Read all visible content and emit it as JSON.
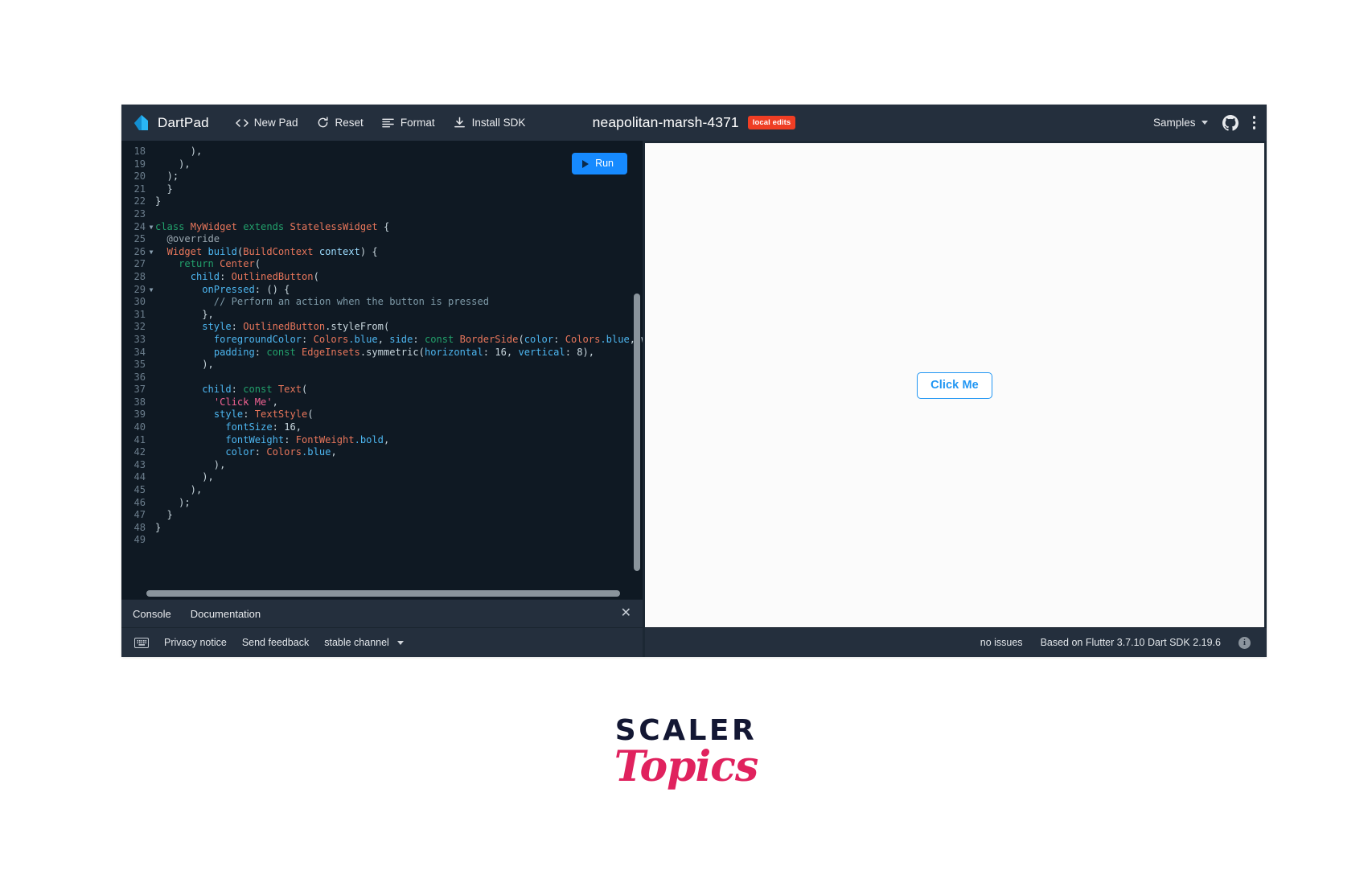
{
  "app": {
    "brand": "DartPad",
    "brand_logo_icon": "dart-bird-logo",
    "doc_title": "neapolitan-marsh-4371",
    "local_edits_badge": "local edits"
  },
  "toolbar": {
    "items": [
      {
        "label": "New Pad",
        "icon": "code-brackets-icon"
      },
      {
        "label": "Reset",
        "icon": "refresh-icon"
      },
      {
        "label": "Format",
        "icon": "format-lines-icon"
      },
      {
        "label": "Install SDK",
        "icon": "download-icon"
      }
    ]
  },
  "header_right": {
    "samples_label": "Samples",
    "samples_chevron_icon": "chevron-down-icon",
    "github_icon": "github-icon",
    "more_icon": "more-vertical-icon"
  },
  "editor": {
    "run_button_label": "Run",
    "run_button_icon": "play-icon",
    "first_line": 18,
    "lines": [
      {
        "n": 18,
        "fold": false,
        "tokens": [
          {
            "t": "      ",
            "c": "pn"
          },
          {
            "t": "),",
            "c": "pn"
          }
        ]
      },
      {
        "n": 19,
        "fold": false,
        "tokens": [
          {
            "t": "    ",
            "c": "pn"
          },
          {
            "t": "),",
            "c": "pn"
          }
        ]
      },
      {
        "n": 20,
        "fold": false,
        "tokens": [
          {
            "t": "  ",
            "c": "pn"
          },
          {
            "t": ");",
            "c": "pn"
          }
        ]
      },
      {
        "n": 21,
        "fold": false,
        "tokens": [
          {
            "t": "  }",
            "c": "pn"
          }
        ]
      },
      {
        "n": 22,
        "fold": false,
        "tokens": [
          {
            "t": "}",
            "c": "pn"
          }
        ]
      },
      {
        "n": 23,
        "fold": false,
        "tokens": []
      },
      {
        "n": 24,
        "fold": true,
        "tokens": [
          {
            "t": "class ",
            "c": "k"
          },
          {
            "t": "MyWidget ",
            "c": "ty"
          },
          {
            "t": "extends ",
            "c": "k"
          },
          {
            "t": "StatelessWidget",
            "c": "ty"
          },
          {
            "t": " {",
            "c": "pn"
          }
        ]
      },
      {
        "n": 25,
        "fold": false,
        "tokens": [
          {
            "t": "  @override",
            "c": "an"
          }
        ]
      },
      {
        "n": 26,
        "fold": true,
        "tokens": [
          {
            "t": "  ",
            "c": "pn"
          },
          {
            "t": "Widget ",
            "c": "ty"
          },
          {
            "t": "build",
            "c": "kk"
          },
          {
            "t": "(",
            "c": "pn"
          },
          {
            "t": "BuildContext ",
            "c": "ty"
          },
          {
            "t": "context",
            "c": "id"
          },
          {
            "t": ") {",
            "c": "pn"
          }
        ]
      },
      {
        "n": 27,
        "fold": false,
        "tokens": [
          {
            "t": "    ",
            "c": "pn"
          },
          {
            "t": "return ",
            "c": "k"
          },
          {
            "t": "Center",
            "c": "ty"
          },
          {
            "t": "(",
            "c": "pn"
          }
        ]
      },
      {
        "n": 28,
        "fold": false,
        "tokens": [
          {
            "t": "      ",
            "c": "pn"
          },
          {
            "t": "child",
            "c": "pm"
          },
          {
            "t": ": ",
            "c": "pn"
          },
          {
            "t": "OutlinedButton",
            "c": "ty"
          },
          {
            "t": "(",
            "c": "pn"
          }
        ]
      },
      {
        "n": 29,
        "fold": true,
        "tokens": [
          {
            "t": "        ",
            "c": "pn"
          },
          {
            "t": "onPressed",
            "c": "pm"
          },
          {
            "t": ": () {",
            "c": "pn"
          }
        ]
      },
      {
        "n": 30,
        "fold": false,
        "tokens": [
          {
            "t": "          // Perform an action when the button is pressed",
            "c": "cm"
          }
        ]
      },
      {
        "n": 31,
        "fold": false,
        "tokens": [
          {
            "t": "        },",
            "c": "pn"
          }
        ]
      },
      {
        "n": 32,
        "fold": false,
        "tokens": [
          {
            "t": "        ",
            "c": "pn"
          },
          {
            "t": "style",
            "c": "pm"
          },
          {
            "t": ": ",
            "c": "pn"
          },
          {
            "t": "OutlinedButton",
            "c": "ty"
          },
          {
            "t": ".styleFrom(",
            "c": "pn"
          }
        ]
      },
      {
        "n": 33,
        "fold": false,
        "tokens": [
          {
            "t": "          ",
            "c": "pn"
          },
          {
            "t": "foregroundColor",
            "c": "pm"
          },
          {
            "t": ": ",
            "c": "pn"
          },
          {
            "t": "Colors",
            "c": "ty"
          },
          {
            "t": ".blue",
            "c": "kk"
          },
          {
            "t": ", ",
            "c": "pn"
          },
          {
            "t": "side",
            "c": "pm"
          },
          {
            "t": ": ",
            "c": "pn"
          },
          {
            "t": "const ",
            "c": "k"
          },
          {
            "t": "BorderSide",
            "c": "ty"
          },
          {
            "t": "(",
            "c": "pn"
          },
          {
            "t": "color",
            "c": "pm"
          },
          {
            "t": ": ",
            "c": "pn"
          },
          {
            "t": "Colors",
            "c": "ty"
          },
          {
            "t": ".blue",
            "c": "kk"
          },
          {
            "t": ", wi",
            "c": "pn"
          }
        ]
      },
      {
        "n": 34,
        "fold": false,
        "tokens": [
          {
            "t": "          ",
            "c": "pn"
          },
          {
            "t": "padding",
            "c": "pm"
          },
          {
            "t": ": ",
            "c": "pn"
          },
          {
            "t": "const ",
            "c": "k"
          },
          {
            "t": "EdgeInsets",
            "c": "ty"
          },
          {
            "t": ".symmetric(",
            "c": "pn"
          },
          {
            "t": "horizontal",
            "c": "pm"
          },
          {
            "t": ": ",
            "c": "pn"
          },
          {
            "t": "16",
            "c": "nu"
          },
          {
            "t": ", ",
            "c": "pn"
          },
          {
            "t": "vertical",
            "c": "pm"
          },
          {
            "t": ": ",
            "c": "pn"
          },
          {
            "t": "8",
            "c": "nu"
          },
          {
            "t": "),",
            "c": "pn"
          }
        ]
      },
      {
        "n": 35,
        "fold": false,
        "tokens": [
          {
            "t": "        ),",
            "c": "pn"
          }
        ]
      },
      {
        "n": 36,
        "fold": false,
        "tokens": []
      },
      {
        "n": 37,
        "fold": false,
        "tokens": [
          {
            "t": "        ",
            "c": "pn"
          },
          {
            "t": "child",
            "c": "pm"
          },
          {
            "t": ": ",
            "c": "pn"
          },
          {
            "t": "const ",
            "c": "k"
          },
          {
            "t": "Text",
            "c": "ty"
          },
          {
            "t": "(",
            "c": "pn"
          }
        ]
      },
      {
        "n": 38,
        "fold": false,
        "tokens": [
          {
            "t": "          ",
            "c": "pn"
          },
          {
            "t": "'Click Me'",
            "c": "st"
          },
          {
            "t": ",",
            "c": "pn"
          }
        ]
      },
      {
        "n": 39,
        "fold": false,
        "tokens": [
          {
            "t": "          ",
            "c": "pn"
          },
          {
            "t": "style",
            "c": "pm"
          },
          {
            "t": ": ",
            "c": "pn"
          },
          {
            "t": "TextStyle",
            "c": "ty"
          },
          {
            "t": "(",
            "c": "pn"
          }
        ]
      },
      {
        "n": 40,
        "fold": false,
        "tokens": [
          {
            "t": "            ",
            "c": "pn"
          },
          {
            "t": "fontSize",
            "c": "pm"
          },
          {
            "t": ": ",
            "c": "pn"
          },
          {
            "t": "16",
            "c": "nu"
          },
          {
            "t": ",",
            "c": "pn"
          }
        ]
      },
      {
        "n": 41,
        "fold": false,
        "tokens": [
          {
            "t": "            ",
            "c": "pn"
          },
          {
            "t": "fontWeight",
            "c": "pm"
          },
          {
            "t": ": ",
            "c": "pn"
          },
          {
            "t": "FontWeight",
            "c": "ty"
          },
          {
            "t": ".bold",
            "c": "kk"
          },
          {
            "t": ",",
            "c": "pn"
          }
        ]
      },
      {
        "n": 42,
        "fold": false,
        "tokens": [
          {
            "t": "            ",
            "c": "pn"
          },
          {
            "t": "color",
            "c": "pm"
          },
          {
            "t": ": ",
            "c": "pn"
          },
          {
            "t": "Colors",
            "c": "ty"
          },
          {
            "t": ".blue",
            "c": "kk"
          },
          {
            "t": ",",
            "c": "pn"
          }
        ]
      },
      {
        "n": 43,
        "fold": false,
        "tokens": [
          {
            "t": "          ),",
            "c": "pn"
          }
        ]
      },
      {
        "n": 44,
        "fold": false,
        "tokens": [
          {
            "t": "        ),",
            "c": "pn"
          }
        ]
      },
      {
        "n": 45,
        "fold": false,
        "tokens": [
          {
            "t": "      ),",
            "c": "pn"
          }
        ]
      },
      {
        "n": 46,
        "fold": false,
        "tokens": [
          {
            "t": "    );",
            "c": "pn"
          }
        ]
      },
      {
        "n": 47,
        "fold": false,
        "tokens": [
          {
            "t": "  }",
            "c": "pn"
          }
        ]
      },
      {
        "n": 48,
        "fold": false,
        "tokens": [
          {
            "t": "}",
            "c": "pn"
          }
        ]
      },
      {
        "n": 49,
        "fold": false,
        "tokens": []
      }
    ]
  },
  "console": {
    "tabs": [
      "Console",
      "Documentation"
    ],
    "close_icon": "close-icon"
  },
  "footer": {
    "keyboard_icon": "keyboard-icon",
    "privacy_label": "Privacy notice",
    "feedback_label": "Send feedback",
    "channel_label": "stable channel",
    "channel_chevron_icon": "chevron-down-icon",
    "issues_label": "no issues",
    "version_label": "Based on Flutter 3.7.10 Dart SDK 2.19.6",
    "info_icon": "info-icon"
  },
  "preview": {
    "button_label": "Click Me"
  },
  "logo": {
    "primary": "SCALER",
    "secondary": "Topics"
  },
  "colors": {
    "accent_blue": "#168aff",
    "badge_red": "#ef3e24",
    "header_bg": "#242f3d",
    "editor_bg": "#0f1923",
    "logo_pink": "#e0225e"
  }
}
